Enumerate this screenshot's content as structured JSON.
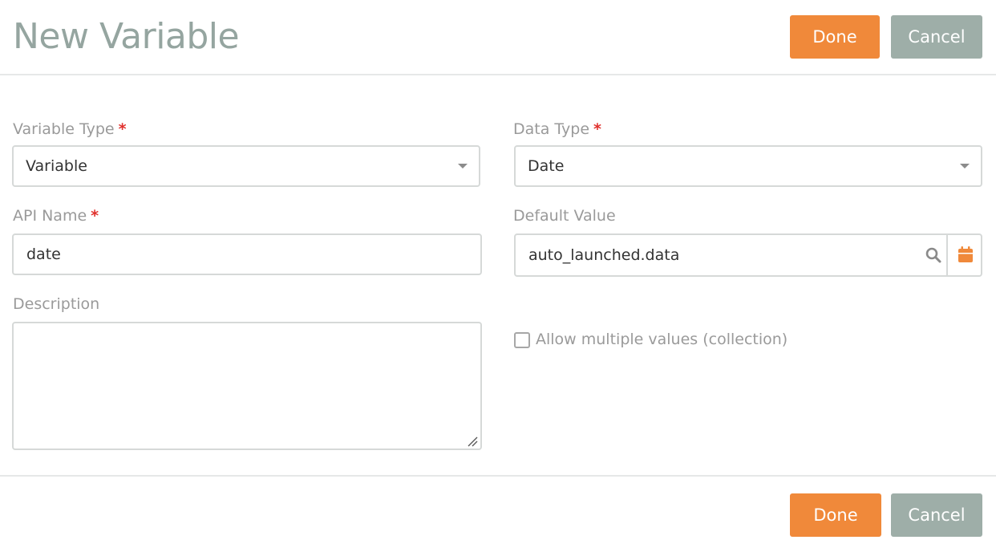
{
  "header": {
    "title": "New Variable",
    "done_label": "Done",
    "cancel_label": "Cancel"
  },
  "form": {
    "variable_type": {
      "label": "Variable Type",
      "required_mark": "*",
      "value": "Variable"
    },
    "data_type": {
      "label": "Data Type",
      "required_mark": "*",
      "value": "Date"
    },
    "api_name": {
      "label": "API Name",
      "required_mark": "*",
      "value": "date"
    },
    "default_value": {
      "label": "Default Value",
      "value": "auto_launched.data"
    },
    "description": {
      "label": "Description",
      "value": ""
    },
    "allow_multiple": {
      "label": "Allow multiple values (collection)",
      "checked": false
    }
  },
  "footer": {
    "done_label": "Done",
    "cancel_label": "Cancel"
  },
  "icons": {
    "dropdown": "caret-down-icon",
    "search": "search-icon",
    "calendar": "calendar-icon",
    "resize": "resize-handle-icon"
  },
  "colors": {
    "accent": "#f0893a",
    "secondary": "#9eaea8",
    "required": "#e0302c",
    "title": "#95a5a0"
  }
}
